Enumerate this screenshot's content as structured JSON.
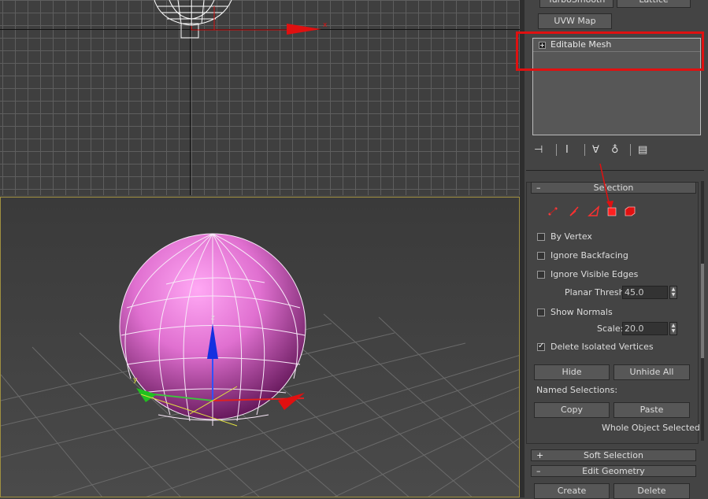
{
  "modifier_buttons": {
    "turbosmooth": "TurboSmooth",
    "lattice": "Lattice",
    "uvw_map": "UVW Map"
  },
  "modifier_stack": {
    "items": [
      {
        "label": "Editable Mesh"
      }
    ]
  },
  "stack_toolbar": {
    "icons": [
      "pin-stack-icon",
      "show-end-result-icon",
      "make-unique-icon",
      "remove-modifier-icon",
      "configure-modifier-sets-icon"
    ]
  },
  "selection_rollout": {
    "title": "Selection",
    "collapse_symbol": "–",
    "levels": [
      "vertex-icon",
      "edge-icon",
      "face-icon",
      "polygon-icon",
      "element-icon"
    ],
    "active_level": "polygon",
    "by_vertex": "By Vertex",
    "ignore_backfacing": "Ignore Backfacing",
    "ignore_visible_edges": "Ignore Visible Edges",
    "planar_thresh_label": "Planar Thresh:",
    "planar_thresh_value": "45.0",
    "show_normals": "Show Normals",
    "scale_label": "Scale:",
    "scale_value": "20.0",
    "delete_isolated": "Delete Isolated Vertices",
    "delete_isolated_checked": true,
    "hide": "Hide",
    "unhide_all": "Unhide All",
    "named_selections_label": "Named Selections:",
    "copy": "Copy",
    "paste": "Paste",
    "status": "Whole Object Selected"
  },
  "soft_selection": {
    "title": "Soft Selection",
    "expand_symbol": "+"
  },
  "edit_geometry": {
    "title": "Edit Geometry",
    "collapse_symbol": "–",
    "create": "Create",
    "delete": "Delete"
  },
  "viewport": {
    "gizmo_x": "x",
    "gizmo_y": "y",
    "gizmo_z": "z"
  },
  "colors": {
    "highlight": "#e01010",
    "sphere": "#e070d0",
    "selected_level": "#ff2020"
  }
}
